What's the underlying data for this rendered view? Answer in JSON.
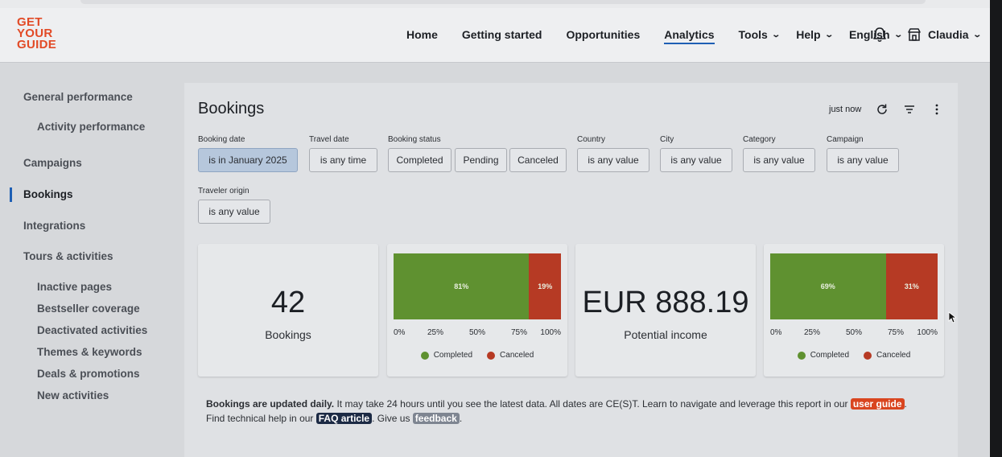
{
  "logo": {
    "lines": [
      "GET",
      "YOUR",
      "GUIDE"
    ],
    "color": "#e24a26"
  },
  "nav": {
    "items": [
      {
        "label": "Home"
      },
      {
        "label": "Getting started"
      },
      {
        "label": "Opportunities"
      },
      {
        "label": "Analytics",
        "active": true
      },
      {
        "label": "Tools",
        "dropdown": true
      },
      {
        "label": "Help",
        "dropdown": true
      },
      {
        "label": "English",
        "dropdown": true
      }
    ],
    "bell_icon": "bell-icon",
    "user": {
      "name": "Claudia",
      "icon": "storefront-icon"
    }
  },
  "sidebar": {
    "items": [
      {
        "label": "General performance"
      },
      {
        "label": "Activity performance"
      },
      {
        "label": "Campaigns"
      },
      {
        "label": "Bookings",
        "active": true
      },
      {
        "label": "Integrations"
      },
      {
        "label": "Tours & activities"
      },
      {
        "label": "Inactive pages"
      },
      {
        "label": "Bestseller coverage"
      },
      {
        "label": "Deactivated activities"
      },
      {
        "label": "Themes & keywords"
      },
      {
        "label": "Deals & promotions"
      },
      {
        "label": "New activities"
      }
    ]
  },
  "main": {
    "title": "Bookings",
    "refresh_status": "just now",
    "filters": {
      "booking_date": {
        "label": "Booking date",
        "value": "is in January 2025"
      },
      "travel_date": {
        "label": "Travel date",
        "value": "is any time"
      },
      "booking_status": {
        "label": "Booking status",
        "options": [
          "Completed",
          "Pending",
          "Canceled"
        ]
      },
      "country": {
        "label": "Country",
        "value": "is any value"
      },
      "city": {
        "label": "City",
        "value": "is any value"
      },
      "category": {
        "label": "Category",
        "value": "is any value"
      },
      "campaign": {
        "label": "Campaign",
        "value": "is any value"
      },
      "traveler_origin": {
        "label": "Traveler origin",
        "value": "is any value"
      }
    },
    "bookings_card": {
      "value": "42",
      "label": "Bookings"
    },
    "income_card": {
      "value": "EUR 888.19",
      "label": "Potential income"
    },
    "note": {
      "bold": "Bookings are updated daily.",
      "text1": " It may take 24 hours until you see the latest data. All dates are CE(S)T. Learn to navigate and leverage this report in our ",
      "link_user_guide": "user guide",
      "text2": ". Find technical help in our ",
      "link_faq": "FAQ article",
      "text3": ". Give us ",
      "link_feedback": "feedback",
      "text4": "."
    }
  },
  "colors": {
    "completed": "#5f9130",
    "canceled": "#b63a24",
    "accent": "#1e5fb4"
  },
  "chart_data": [
    {
      "type": "bar",
      "stacked": true,
      "orientation": "horizontal",
      "ticks": [
        "0%",
        "25%",
        "50%",
        "75%",
        "100%"
      ],
      "series": [
        {
          "name": "Completed",
          "values": [
            81
          ],
          "label": "81%"
        },
        {
          "name": "Canceled",
          "values": [
            19
          ],
          "label": "19%"
        }
      ],
      "legend": [
        "Completed",
        "Canceled"
      ]
    },
    {
      "type": "bar",
      "stacked": true,
      "orientation": "horizontal",
      "ticks": [
        "0%",
        "25%",
        "50%",
        "75%",
        "100%"
      ],
      "series": [
        {
          "name": "Completed",
          "values": [
            69
          ],
          "label": "69%"
        },
        {
          "name": "Canceled",
          "values": [
            31
          ],
          "label": "31%"
        }
      ],
      "legend": [
        "Completed",
        "Canceled"
      ]
    }
  ]
}
